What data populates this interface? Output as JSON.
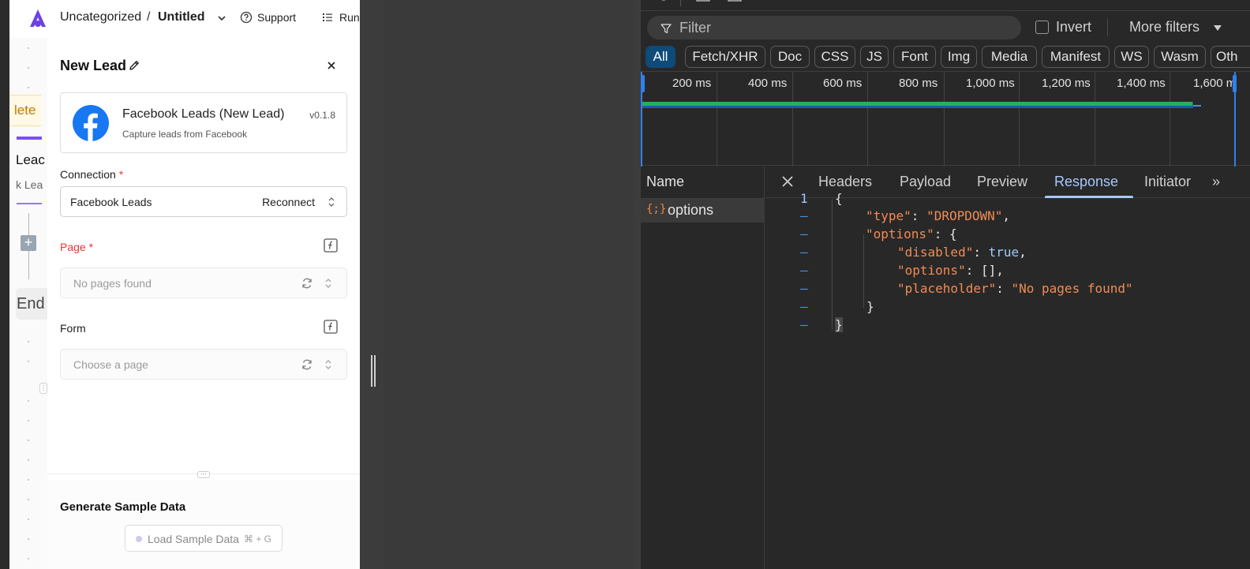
{
  "app": {
    "breadcrumb": {
      "folder": "Uncategorized",
      "separator": "/",
      "flow_title": "Untitled"
    },
    "support_label": "Support",
    "runs_label": "Runs"
  },
  "canvas": {
    "complete_label": "lete",
    "lead_label": "Leac",
    "lead_sub_label": "k Lea",
    "add_symbol": "+",
    "end_label": "End"
  },
  "panel": {
    "title": "New Lead",
    "piece": {
      "name": "Facebook Leads (New Lead)",
      "version": "v0.1.8",
      "description": "Capture leads from Facebook"
    },
    "connection": {
      "label": "Connection",
      "required_mark": "*",
      "value": "Facebook Leads",
      "reconnect_label": "Reconnect"
    },
    "page_field": {
      "label": "Page",
      "required_mark": "*",
      "placeholder": "No pages found"
    },
    "form_field": {
      "label": "Form",
      "placeholder": "Choose a page"
    },
    "sample": {
      "title": "Generate Sample Data",
      "button_label": "Load Sample Data",
      "shortcut": "⌘ + G"
    }
  },
  "devtools": {
    "filter_placeholder": "Filter",
    "invert_label": "Invert",
    "invert_checked": false,
    "more_filters_label": "More filters",
    "type_filters": [
      "All",
      "Fetch/XHR",
      "Doc",
      "CSS",
      "JS",
      "Font",
      "Img",
      "Media",
      "Manifest",
      "WS",
      "Wasm",
      "Oth"
    ],
    "active_filter": "All",
    "timeline_labels": [
      "200 ms",
      "400 ms",
      "600 ms",
      "800 ms",
      "1,000 ms",
      "1,200 ms",
      "1,400 ms",
      "1,600 m"
    ],
    "name_header": "Name",
    "request": {
      "icon": "{;}",
      "name": "options"
    },
    "tabs": [
      "Headers",
      "Payload",
      "Preview",
      "Response",
      "Initiator"
    ],
    "active_tab": "Response",
    "more_tabs_symbol": "»",
    "response_lines": [
      {
        "num": "1",
        "text": "{"
      },
      {
        "num": "–",
        "key": "\"type\"",
        "sep": ": ",
        "val": "\"DROPDOWN\"",
        "end": ","
      },
      {
        "num": "–",
        "key": "\"options\"",
        "sep": ": ",
        "val": "{",
        "end": ""
      },
      {
        "num": "–",
        "key": "\"disabled\"",
        "sep": ": ",
        "val": "true",
        "end": ","
      },
      {
        "num": "–",
        "key": "\"options\"",
        "sep": ": ",
        "val": "[]",
        "end": ","
      },
      {
        "num": "–",
        "key": "\"placeholder\"",
        "sep": ": ",
        "val": "\"No pages found\"",
        "end": ""
      },
      {
        "num": "–",
        "text": "}"
      },
      {
        "num": "–",
        "text": "}"
      }
    ]
  },
  "colors": {
    "brand_purple": "#6e41e2",
    "facebook_blue": "#1877f2",
    "required_red": "#e53935",
    "devtools_active_tab": "#a8c7fa",
    "json_string": "#f28b54",
    "timeline_green": "#27b05a"
  }
}
